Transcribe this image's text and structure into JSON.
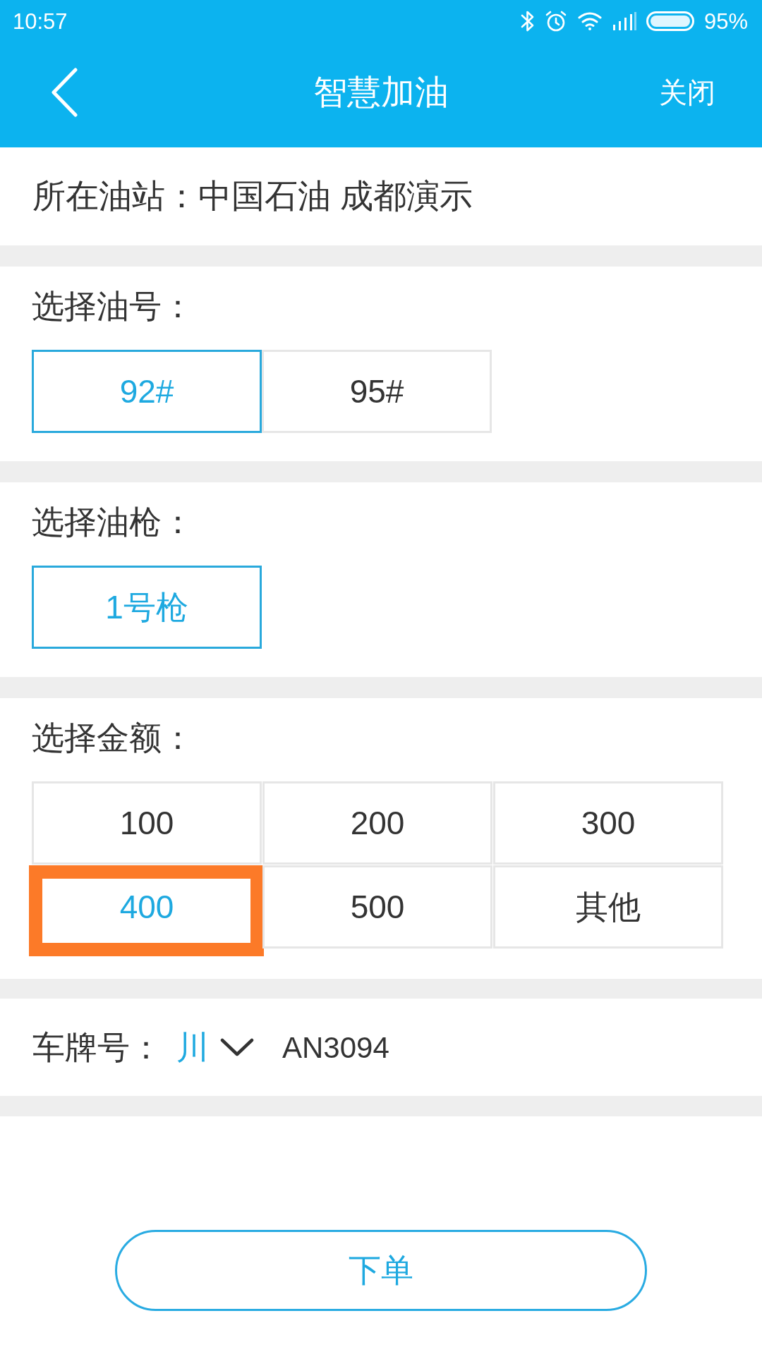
{
  "status_bar": {
    "time": "10:57",
    "battery": "95%"
  },
  "header": {
    "title": "智慧加油",
    "action": "关闭"
  },
  "station": {
    "text": "所在油站：中国石油 成都演示"
  },
  "fuel": {
    "label": "选择油号：",
    "options": [
      {
        "label": "92#",
        "selected": true
      },
      {
        "label": "95#",
        "selected": false
      }
    ]
  },
  "nozzle": {
    "label": "选择油枪：",
    "options": [
      {
        "label": "1号枪",
        "selected": true
      }
    ]
  },
  "amount": {
    "label": "选择金额：",
    "options": [
      {
        "label": "100",
        "selected": false,
        "highlighted": false
      },
      {
        "label": "200",
        "selected": false,
        "highlighted": false
      },
      {
        "label": "300",
        "selected": false,
        "highlighted": false
      },
      {
        "label": "400",
        "selected": true,
        "highlighted": true
      },
      {
        "label": "500",
        "selected": false,
        "highlighted": false
      },
      {
        "label": "其他",
        "selected": false,
        "highlighted": false
      }
    ]
  },
  "plate": {
    "label": "车牌号：",
    "province": "川",
    "number": "AN3094"
  },
  "submit_button": {
    "label": "下单"
  }
}
